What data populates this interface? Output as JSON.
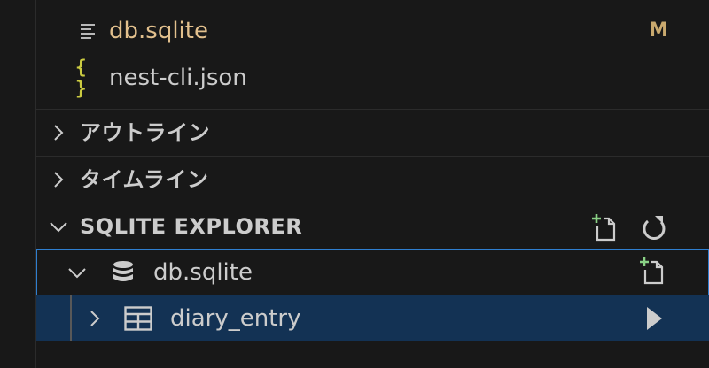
{
  "files": [
    {
      "name": "db.sqlite",
      "icon": "text-file-icon",
      "badge": "M",
      "color": "#e2c08d"
    },
    {
      "name": "nest-cli.json",
      "icon": "braces-icon",
      "icon_text": "{ }",
      "color": "#cccccc"
    }
  ],
  "sections": {
    "outline": {
      "title": "アウトライン"
    },
    "timeline": {
      "title": "タイムライン"
    },
    "sqlite": {
      "title": "SQLITE EXPLORER"
    }
  },
  "tree": {
    "database": {
      "label": "db.sqlite"
    },
    "table": {
      "label": "diary_entry"
    }
  },
  "colors": {
    "background": "#181818",
    "modified": "#e2c08d",
    "selection": "#133254",
    "focus_border": "#2f7fd0",
    "json_icon": "#cbcb41"
  }
}
